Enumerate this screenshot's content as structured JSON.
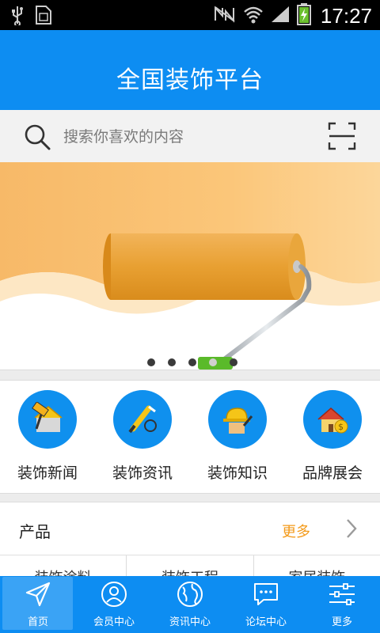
{
  "status_bar": {
    "time": "17:27",
    "left_icons": [
      "usb-icon",
      "sim-card-icon"
    ],
    "right_icons": [
      "nfc-icon",
      "wifi-icon",
      "signal-icon",
      "battery-charging-icon"
    ]
  },
  "header": {
    "title": "全国装饰平台"
  },
  "search": {
    "placeholder": "搜索你喜欢的内容",
    "icon": "search-icon",
    "scan_icon": "scan-icon"
  },
  "banner": {
    "image": "paint-roller-banner",
    "dot_count": 5,
    "active_index": 3
  },
  "categories": [
    {
      "label": "装饰新闻",
      "icon": "paint-roller-icon"
    },
    {
      "label": "装饰资讯",
      "icon": "paintbrush-icon"
    },
    {
      "label": "装饰知识",
      "icon": "worker-icon"
    },
    {
      "label": "品牌展会",
      "icon": "house-money-icon"
    }
  ],
  "products": {
    "title": "产品",
    "more": "更多",
    "items": [
      "装饰涂料",
      "装饰工程",
      "家居装饰"
    ]
  },
  "bottom_nav": [
    {
      "label": "首页",
      "icon": "home-send-icon",
      "active": true
    },
    {
      "label": "会员中心",
      "icon": "user-icon",
      "active": false
    },
    {
      "label": "资讯中心",
      "icon": "globe-icon",
      "active": false
    },
    {
      "label": "论坛中心",
      "icon": "chat-icon",
      "active": false
    },
    {
      "label": "更多",
      "icon": "sliders-icon",
      "active": false
    }
  ],
  "colors": {
    "primary": "#0d8df2",
    "accent_more": "#f39a1a",
    "category_circle": "#0f90ee"
  }
}
